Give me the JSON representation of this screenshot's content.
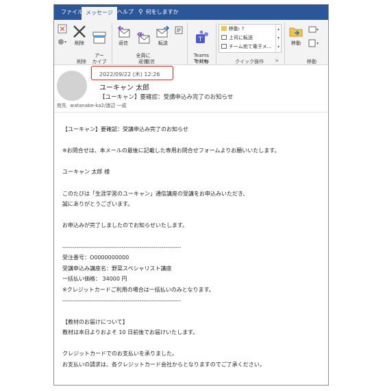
{
  "tabs": [
    {
      "label": "ファイル"
    },
    {
      "label": "メッセージ"
    },
    {
      "label": "ヘルプ"
    }
  ],
  "search": {
    "label": "何をしますか",
    "icon": "lightbulb-icon"
  },
  "ribbon": {
    "delete_group": {
      "label": "削除",
      "buttons": [
        {
          "label": "削除",
          "icon": "delete-x-icon"
        },
        {
          "label": "アー\nカイブ",
          "icon": "archive-icon"
        }
      ]
    },
    "reply_group": {
      "label": "返信",
      "buttons": [
        {
          "label": "返信",
          "icon": "reply-icon"
        },
        {
          "label": "全員に\n返信",
          "icon": "reply-all-icon"
        },
        {
          "label": "転送",
          "icon": "forward-icon"
        }
      ]
    },
    "teams_group": {
      "label": "Teams",
      "button": {
        "label": "Teams\nで共有",
        "icon": "teams-icon"
      }
    },
    "quick_group": {
      "label": "クイック操作",
      "items": [
        "移動: ?",
        "上司に転送",
        "チーム宛て電子メ…"
      ]
    },
    "move_group": {
      "label": "移動",
      "button": {
        "label": "移動",
        "icon": "folder-move-icon"
      }
    }
  },
  "message": {
    "date": "2022/09/22 (木) 12:26",
    "sender": "ユーキャン 太郎",
    "subject": "【ユーキャン】要確認：受講申込み完了のお知らせ",
    "to_label": "宛先",
    "to": "watanabe-ka2/渡辺 一成"
  },
  "body_lines": [
    "【ユーキャン】要確認：受講申込み完了のお知らせ",
    "",
    "※お問合せは、本メールの最後に記載した専用お問合せフォームよりお願いいたします。",
    "",
    "ユーキャン 太郎 様",
    "",
    "このたびは「生涯学習のユーキャン」通信講座の受講をお申込みいただき、",
    "誠にありがとうございます。",
    "",
    "お申込みが完了しましたのでお知らせいたします。",
    "",
    "------------------------------------------------------------",
    "受注番号：O0000000000",
    "受講申込み講座名：野菜スペシャリスト講座",
    "一括払い価格： 34000 円",
    "※クレジットカードご利用の場合は一括払いのみとなります。",
    "------------------------------------------------------------",
    "",
    "【教材のお届けについて】",
    "教材は本日よりおよそ 10 日前後でお届けいたします。",
    "",
    "クレジットカードでのお支払いを承りました。",
    "お支払いの請求は、各クレジットカード会社からとなりますのでご了承ください。"
  ],
  "colors": {
    "tabbar": "#2b579a",
    "highlight": "#d62020",
    "ribbon": "#f3f3f3"
  }
}
